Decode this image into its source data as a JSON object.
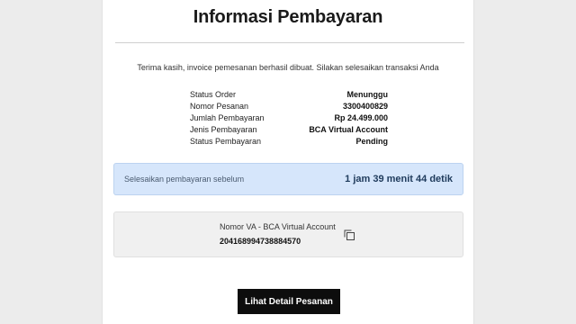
{
  "header": {
    "title": "Informasi Pembayaran"
  },
  "message": "Terima kasih, invoice pemesanan berhasil dibuat. Silakan selesaikan transaksi Anda",
  "details": [
    {
      "label": "Status Order",
      "value": "Menunggu"
    },
    {
      "label": "Nomor Pesanan",
      "value": "3300400829"
    },
    {
      "label": "Jumlah Pembayaran",
      "value": "Rp 24.499.000"
    },
    {
      "label": "Jenis Pembayaran",
      "value": "BCA Virtual Account"
    },
    {
      "label": "Status Pembayaran",
      "value": "Pending"
    }
  ],
  "deadline": {
    "label": "Selesaikan pembayaran sebelum",
    "countdown": "1 jam 39 menit 44 detik"
  },
  "va": {
    "label": "Nomor VA - BCA Virtual Account",
    "number": "204168994738884570",
    "copy_icon": "copy-icon"
  },
  "actions": {
    "detail_button": "Lihat Detail Pesanan"
  },
  "colors": {
    "deadline_bg": "#d6e6fb",
    "countdown_text": "#1f3b5c",
    "button_bg": "#0d0d0d"
  }
}
